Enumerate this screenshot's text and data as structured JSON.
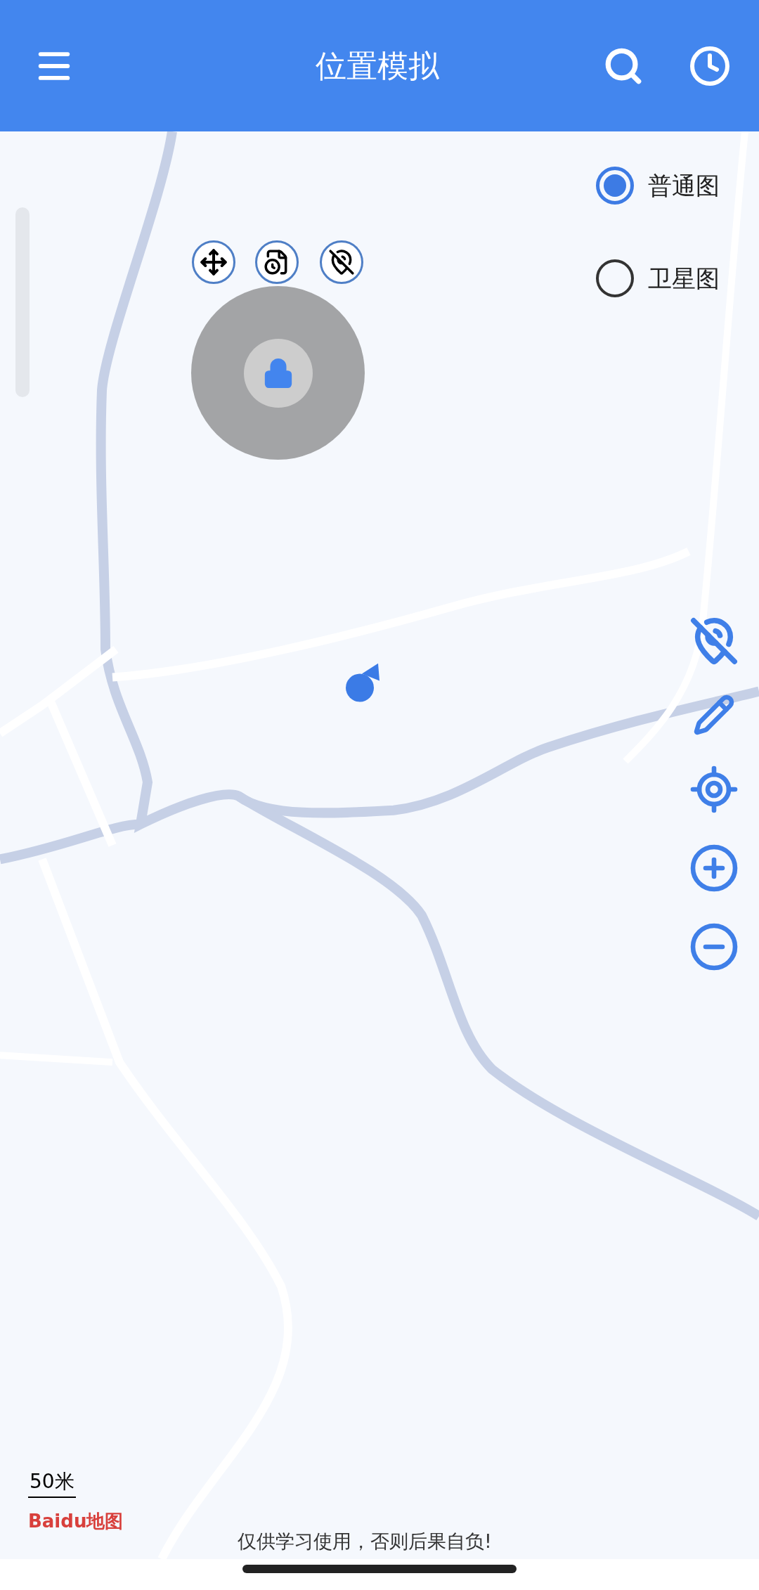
{
  "header": {
    "title": "位置模拟"
  },
  "map_type": [
    {
      "label": "普通图",
      "selected": true
    },
    {
      "label": "卫星图",
      "selected": false
    }
  ],
  "scale": "50米",
  "map_logo": {
    "brand": "Baidu",
    "suffix": "地图"
  },
  "disclaimer": "仅供学习使用，否则后果自负!"
}
